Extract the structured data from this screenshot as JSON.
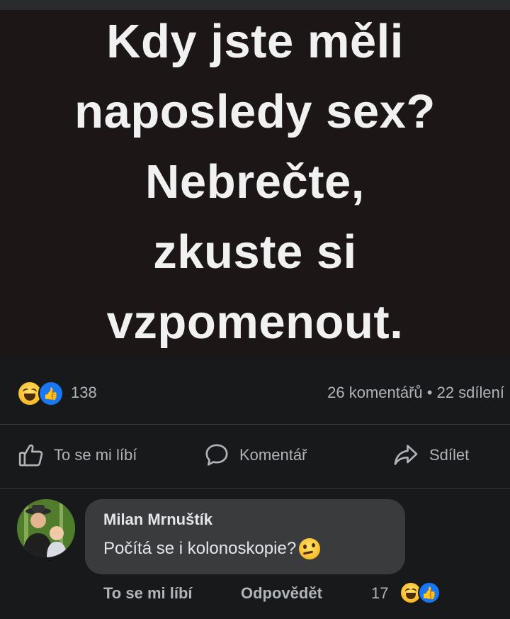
{
  "post": {
    "text_lines": "Kdy jste měli\nnaposledy sex?\nNebrečte,\nzkuste si\nvzpomenout."
  },
  "stats": {
    "reaction_icons": [
      "haha-emoji-icon",
      "like-icon"
    ],
    "reaction_count": "138",
    "comments_shares": "26 komentářů • 22 sdílení"
  },
  "actions": {
    "like_label": "To se mi líbí",
    "comment_label": "Komentář",
    "share_label": "Sdílet"
  },
  "comment": {
    "author": "Milan Mrnuštík",
    "text": "Počítá se i kolonoskopie?",
    "emoji": "thinking-emoji-icon",
    "like_label": "To se mi líbí",
    "reply_label": "Odpovědět",
    "reaction_count": "17"
  },
  "colors": {
    "background": "#18191a",
    "post_image_bg": "#1c1617",
    "bubble": "#3a3b3c",
    "secondary_text": "#b0b3b8",
    "like_blue": "#1877f2"
  }
}
